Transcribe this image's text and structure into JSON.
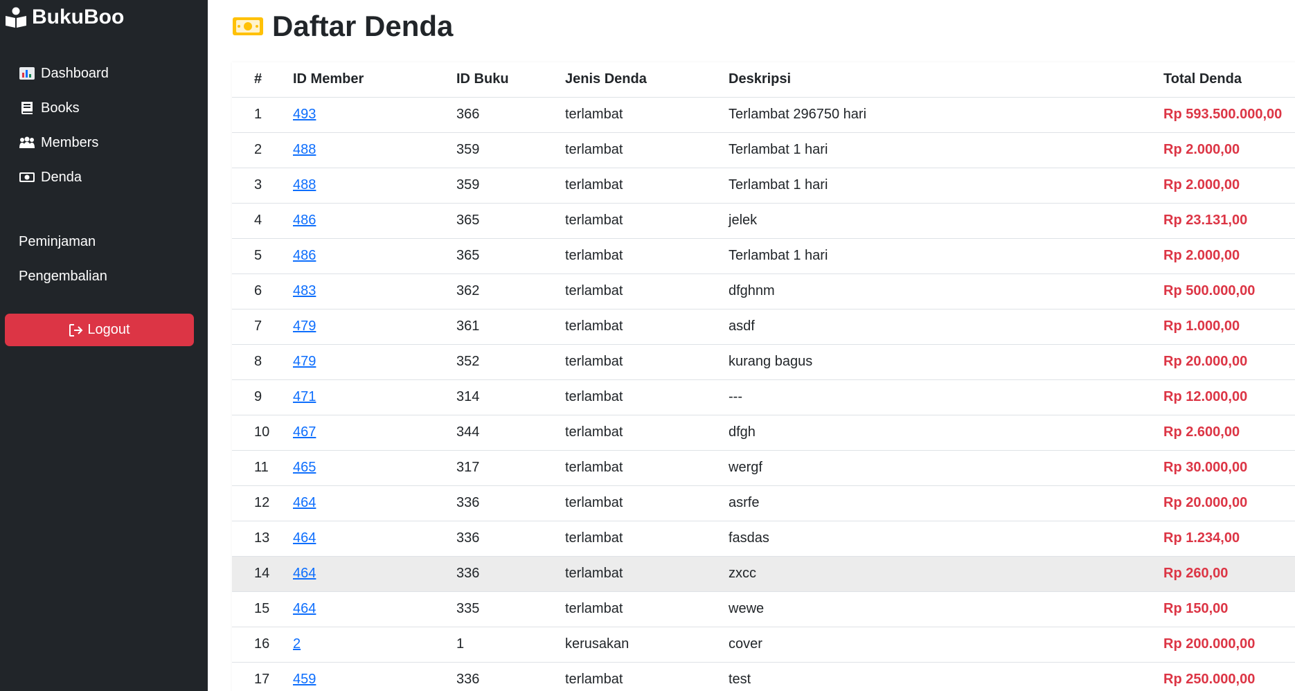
{
  "sidebar": {
    "brand": "BukuBoo",
    "nav": [
      {
        "label": "Dashboard",
        "icon": "chart-icon"
      },
      {
        "label": "Books",
        "icon": "book-icon"
      },
      {
        "label": "Members",
        "icon": "users-icon"
      },
      {
        "label": "Denda",
        "icon": "money-icon"
      }
    ],
    "nav2": [
      {
        "label": "Peminjaman"
      },
      {
        "label": "Pengembalian"
      }
    ],
    "logout_label": "Logout"
  },
  "page": {
    "title": "Daftar Denda"
  },
  "table": {
    "headers": [
      "#",
      "ID Member",
      "ID Buku",
      "Jenis Denda",
      "Deskripsi",
      "Total Denda"
    ],
    "rows": [
      {
        "no": "1",
        "member": "493",
        "buku": "366",
        "jenis": "terlambat",
        "deskripsi": "Terlambat 296750 hari",
        "total": "Rp 593.500.000,00"
      },
      {
        "no": "2",
        "member": "488",
        "buku": "359",
        "jenis": "terlambat",
        "deskripsi": "Terlambat 1 hari",
        "total": "Rp 2.000,00"
      },
      {
        "no": "3",
        "member": "488",
        "buku": "359",
        "jenis": "terlambat",
        "deskripsi": "Terlambat 1 hari",
        "total": "Rp 2.000,00"
      },
      {
        "no": "4",
        "member": "486",
        "buku": "365",
        "jenis": "terlambat",
        "deskripsi": "jelek",
        "total": "Rp 23.131,00"
      },
      {
        "no": "5",
        "member": "486",
        "buku": "365",
        "jenis": "terlambat",
        "deskripsi": "Terlambat 1 hari",
        "total": "Rp 2.000,00"
      },
      {
        "no": "6",
        "member": "483",
        "buku": "362",
        "jenis": "terlambat",
        "deskripsi": "dfghnm",
        "total": "Rp 500.000,00"
      },
      {
        "no": "7",
        "member": "479",
        "buku": "361",
        "jenis": "terlambat",
        "deskripsi": "asdf",
        "total": "Rp 1.000,00"
      },
      {
        "no": "8",
        "member": "479",
        "buku": "352",
        "jenis": "terlambat",
        "deskripsi": "kurang bagus",
        "total": "Rp 20.000,00"
      },
      {
        "no": "9",
        "member": "471",
        "buku": "314",
        "jenis": "terlambat",
        "deskripsi": "---",
        "total": "Rp 12.000,00"
      },
      {
        "no": "10",
        "member": "467",
        "buku": "344",
        "jenis": "terlambat",
        "deskripsi": "dfgh",
        "total": "Rp 2.600,00"
      },
      {
        "no": "11",
        "member": "465",
        "buku": "317",
        "jenis": "terlambat",
        "deskripsi": "wergf",
        "total": "Rp 30.000,00"
      },
      {
        "no": "12",
        "member": "464",
        "buku": "336",
        "jenis": "terlambat",
        "deskripsi": "asrfe",
        "total": "Rp 20.000,00"
      },
      {
        "no": "13",
        "member": "464",
        "buku": "336",
        "jenis": "terlambat",
        "deskripsi": "fasdas",
        "total": "Rp 1.234,00"
      },
      {
        "no": "14",
        "member": "464",
        "buku": "336",
        "jenis": "terlambat",
        "deskripsi": "zxcc",
        "total": "Rp 260,00",
        "highlighted": true
      },
      {
        "no": "15",
        "member": "464",
        "buku": "335",
        "jenis": "terlambat",
        "deskripsi": "wewe",
        "total": "Rp 150,00"
      },
      {
        "no": "16",
        "member": "2",
        "buku": "1",
        "jenis": "kerusakan",
        "deskripsi": "cover",
        "total": "Rp 200.000,00"
      },
      {
        "no": "17",
        "member": "459",
        "buku": "336",
        "jenis": "terlambat",
        "deskripsi": "test",
        "total": "Rp 250.000,00"
      }
    ]
  },
  "colors": {
    "sidebar_bg": "#212529",
    "danger": "#dc3545",
    "link": "#0d6efd",
    "money_icon": "#ffc107"
  }
}
